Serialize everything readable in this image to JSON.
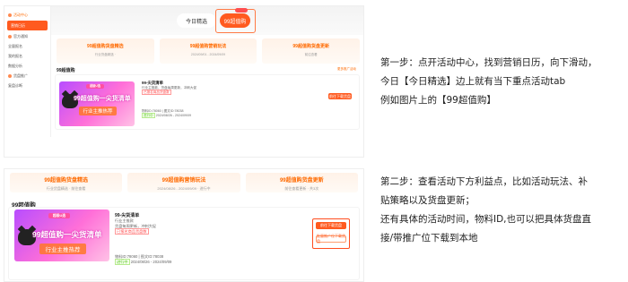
{
  "step1": {
    "sidebar": {
      "items": [
        {
          "label": "活动中心",
          "active": false
        },
        {
          "label": "营销日历",
          "active": true
        },
        {
          "label": "官方通知",
          "active": false
        },
        {
          "label": "全量报名",
          "active": false
        },
        {
          "label": "我的报名",
          "active": false
        },
        {
          "label": "数据分析",
          "active": false
        },
        {
          "label": "货盘推广",
          "active": false
        },
        {
          "label": "复盘诊断",
          "active": false
        }
      ]
    },
    "tabs": [
      {
        "label": "今日精选"
      },
      {
        "label": "99超值购"
      }
    ],
    "cards": [
      {
        "title": "99超值购货盘精选",
        "sub": "行业货盘精选 ·"
      },
      {
        "title": "99超值购营销玩法",
        "sub": "2024/09/01 - 2024/09/09"
      },
      {
        "title": "99超值购货盘更新",
        "sub": "前往查看"
      }
    ],
    "section_label": "99超值购",
    "more_link": "更多推广活动",
    "activity": {
      "banner_logo": "超级U选",
      "banner_headline": "99超值购一尖货清单",
      "banner_sub": "行业主推热荐",
      "title": "99-尖货清单",
      "line1": "行业主推款，货盘每周更新，冲刺大促",
      "line2": "已报名商品货盘数",
      "material_id": "物料ID:78060",
      "id_note": "| 图文ID:78038",
      "tag": "进行中",
      "period": "2024/08/26 - 2024/09/09",
      "btn_download": "前往下载货盘",
      "btn_promo": "批量推广位下载货盘"
    }
  },
  "step2": {
    "cards": [
      {
        "title": "99超值购货盘精选",
        "sub": "行业货盘精选 · 前往查看"
      },
      {
        "title": "99超值购营销玩法",
        "sub": "2024/08/26 - 2024/09/09 · 进行中"
      },
      {
        "title": "99超值购货盘更新",
        "sub": "前往查看更新 · 共3次"
      }
    ],
    "section_label": "99超值购",
    "activity": {
      "banner_logo": "超级U选",
      "banner_headline": "99超值购一尖货清单",
      "banner_sub": "行业主推热荐",
      "title": "99-尖货清单",
      "line1": "行业主推款",
      "line2": "货盘每周更新，冲刺大促",
      "line3": "已报名商品货盘数",
      "material_id": "物料ID:78060",
      "id_note": "| 图文ID:78038",
      "tag": "进行中",
      "period": "2024/08/26 - 2024/09/09",
      "btn_download": "前往下载货盘",
      "btn_promo": "批量推广位下载货盘"
    }
  },
  "descriptions": {
    "step1": [
      "第一步：点开活动中心，找到营销日历，向下滑动，",
      "今日【今日精选】边上就有当下重点活动tab",
      "例如图片上的【99超值购】"
    ],
    "step2": [
      "第二步：查看活动下方利益点，比如活动玩法、补",
      "贴策略以及货盘更新；",
      "还有具体的活动时间，物料ID,也可以把具体货盘直",
      "接/带推广位下载到本地"
    ]
  }
}
